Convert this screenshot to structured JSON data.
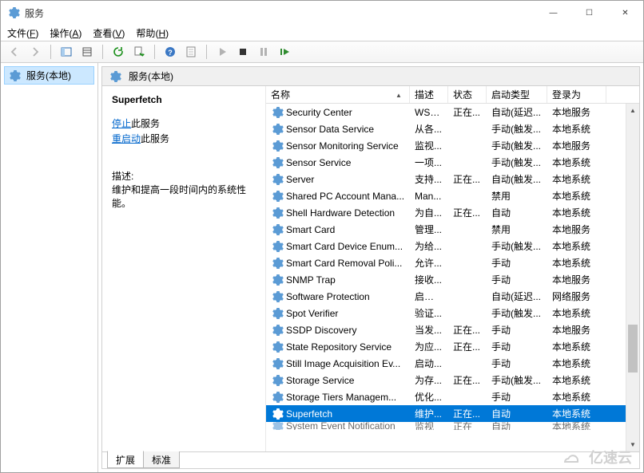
{
  "window": {
    "title": "服务",
    "buttons": {
      "min": "—",
      "max": "☐",
      "close": "✕"
    }
  },
  "menu": {
    "file": {
      "label": "文件",
      "accel": "F"
    },
    "action": {
      "label": "操作",
      "accel": "A"
    },
    "view": {
      "label": "查看",
      "accel": "V"
    },
    "help": {
      "label": "帮助",
      "accel": "H"
    }
  },
  "left_tree": {
    "root_label": "服务(本地)"
  },
  "right_header": {
    "label": "服务(本地)"
  },
  "detail": {
    "selected_name": "Superfetch",
    "stop_link": "停止",
    "stop_suffix": "此服务",
    "restart_link": "重启动",
    "restart_suffix": "此服务",
    "desc_label": "描述:",
    "desc_body": "维护和提高一段时间内的系统性能。"
  },
  "columns": {
    "name": "名称",
    "desc": "描述",
    "status": "状态",
    "startup": "启动类型",
    "logon": "登录为"
  },
  "rows": [
    {
      "name": "Security Center",
      "desc": "WSC...",
      "status": "正在...",
      "startup": "自动(延迟...",
      "logon": "本地服务"
    },
    {
      "name": "Sensor Data Service",
      "desc": "从各...",
      "status": "",
      "startup": "手动(触发...",
      "logon": "本地系统"
    },
    {
      "name": "Sensor Monitoring Service",
      "desc": "监视...",
      "status": "",
      "startup": "手动(触发...",
      "logon": "本地服务"
    },
    {
      "name": "Sensor Service",
      "desc": "一项...",
      "status": "",
      "startup": "手动(触发...",
      "logon": "本地系统"
    },
    {
      "name": "Server",
      "desc": "支持...",
      "status": "正在...",
      "startup": "自动(触发...",
      "logon": "本地系统"
    },
    {
      "name": "Shared PC Account Mana...",
      "desc": "Man...",
      "status": "",
      "startup": "禁用",
      "logon": "本地系统"
    },
    {
      "name": "Shell Hardware Detection",
      "desc": "为自...",
      "status": "正在...",
      "startup": "自动",
      "logon": "本地系统"
    },
    {
      "name": "Smart Card",
      "desc": "管理...",
      "status": "",
      "startup": "禁用",
      "logon": "本地服务"
    },
    {
      "name": "Smart Card Device Enum...",
      "desc": "为给...",
      "status": "",
      "startup": "手动(触发...",
      "logon": "本地系统"
    },
    {
      "name": "Smart Card Removal Poli...",
      "desc": "允许...",
      "status": "",
      "startup": "手动",
      "logon": "本地系统"
    },
    {
      "name": "SNMP Trap",
      "desc": "接收...",
      "status": "",
      "startup": "手动",
      "logon": "本地服务"
    },
    {
      "name": "Software Protection",
      "desc": "启用 ...",
      "status": "",
      "startup": "自动(延迟...",
      "logon": "网络服务"
    },
    {
      "name": "Spot Verifier",
      "desc": "验证...",
      "status": "",
      "startup": "手动(触发...",
      "logon": "本地系统"
    },
    {
      "name": "SSDP Discovery",
      "desc": "当发...",
      "status": "正在...",
      "startup": "手动",
      "logon": "本地服务"
    },
    {
      "name": "State Repository Service",
      "desc": "为应...",
      "status": "正在...",
      "startup": "手动",
      "logon": "本地系统"
    },
    {
      "name": "Still Image Acquisition Ev...",
      "desc": "启动...",
      "status": "",
      "startup": "手动",
      "logon": "本地系统"
    },
    {
      "name": "Storage Service",
      "desc": "为存...",
      "status": "正在...",
      "startup": "手动(触发...",
      "logon": "本地系统"
    },
    {
      "name": "Storage Tiers Managem...",
      "desc": "优化...",
      "status": "",
      "startup": "手动",
      "logon": "本地系统"
    },
    {
      "name": "Superfetch",
      "desc": "维护...",
      "status": "正在...",
      "startup": "自动",
      "logon": "本地系统",
      "selected": true
    },
    {
      "name": "System Event Notification",
      "desc": "监视",
      "status": "正在",
      "startup": "自动",
      "logon": "本地系统",
      "cut": true
    }
  ],
  "tabs": {
    "extended": "扩展",
    "standard": "标准"
  },
  "watermark": "亿速云"
}
